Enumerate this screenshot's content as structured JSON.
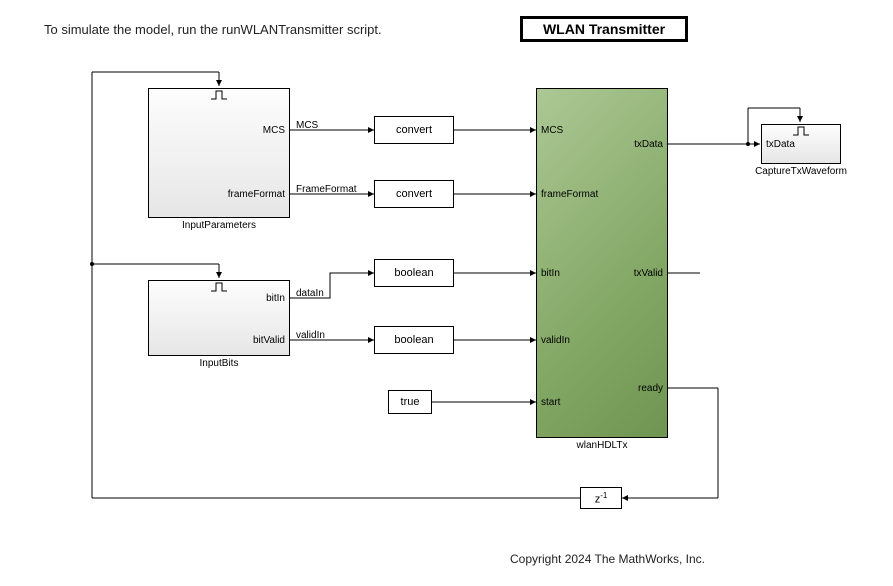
{
  "instruction": "To simulate the model, run the runWLANTransmitter script.",
  "title": "WLAN Transmitter",
  "copyright": "Copyright 2024 The MathWorks, Inc.",
  "blocks": {
    "inputParameters": {
      "caption": "InputParameters",
      "outPorts": {
        "mcs": "MCS",
        "frameFormat": "frameFormat"
      }
    },
    "inputBits": {
      "caption": "InputBits",
      "outPorts": {
        "bitIn": "bitIn",
        "bitValid": "bitValid"
      }
    },
    "convert1": "convert",
    "convert2": "convert",
    "boolean1": "boolean",
    "boolean2": "boolean",
    "constTrue": "true",
    "wlan": {
      "caption": "wlanHDLTx",
      "inPorts": {
        "mcs": "MCS",
        "frameFormat": "frameFormat",
        "bitIn": "bitIn",
        "validIn": "validIn",
        "start": "start"
      },
      "outPorts": {
        "txData": "txData",
        "txValid": "txValid",
        "ready": "ready"
      }
    },
    "capture": {
      "caption": "CaptureTxWaveform",
      "inPorts": {
        "txData": "txData"
      }
    },
    "delay": {
      "label_html": "z",
      "sup": "-1"
    }
  },
  "signals": {
    "mcs": "MCS",
    "frameFormat": "FrameFormat",
    "dataIn": "dataIn",
    "validIn": "validIn"
  }
}
